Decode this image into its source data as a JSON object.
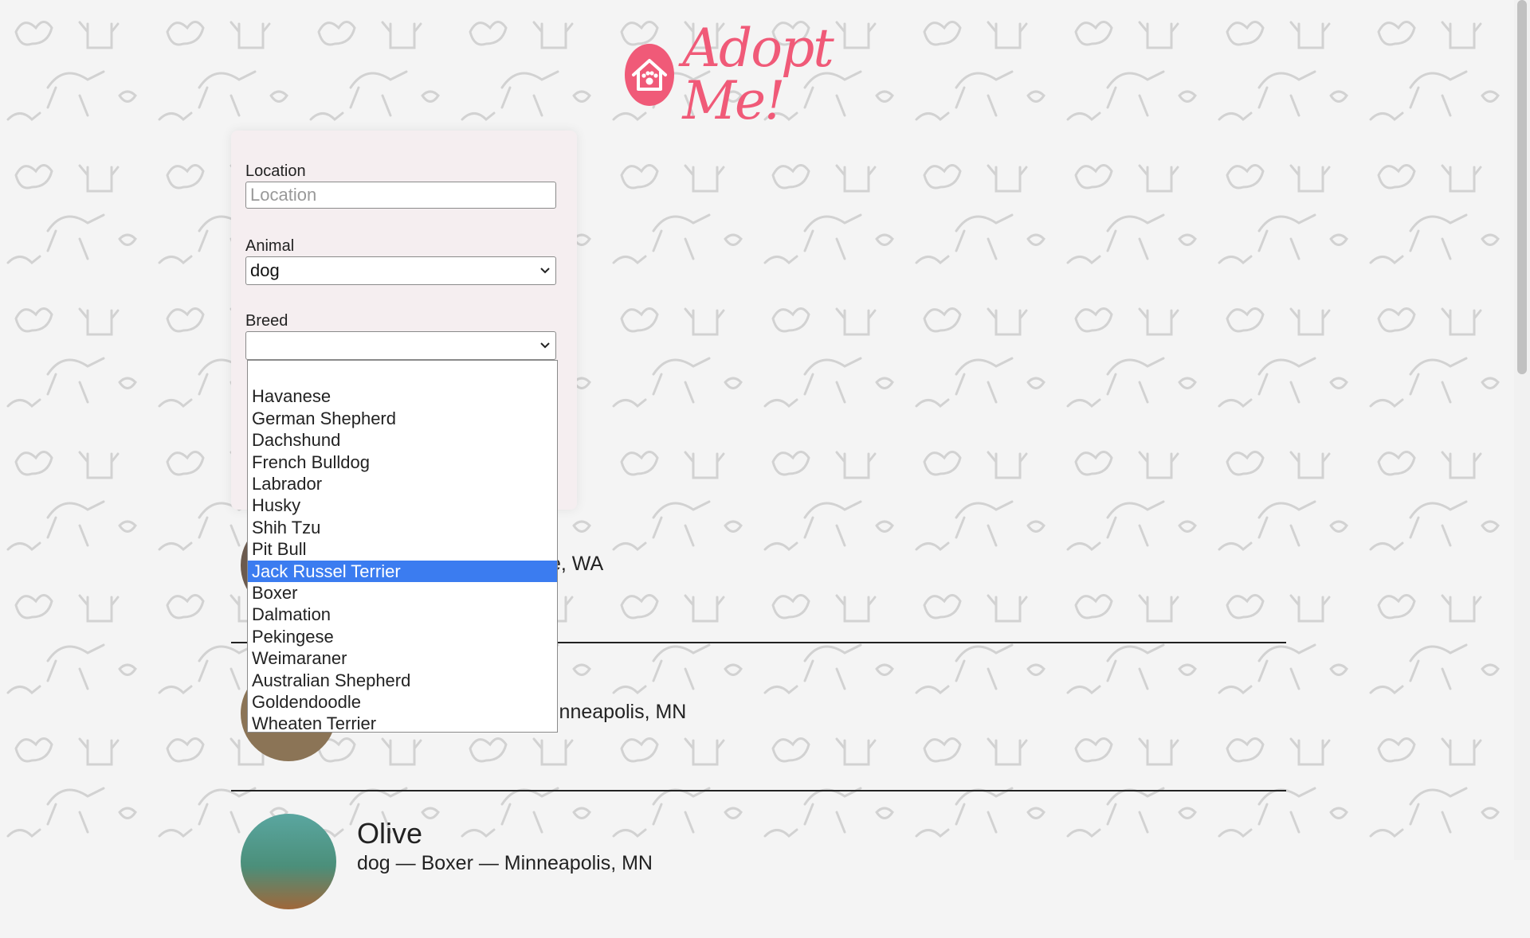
{
  "app": {
    "logo_text": "Adopt Me!"
  },
  "search": {
    "location_label": "Location",
    "location_placeholder": "Location",
    "location_value": "",
    "animal_label": "Animal",
    "animal_value": "dog",
    "breed_label": "Breed",
    "breed_value": ""
  },
  "breed_options": [
    "",
    "Havanese",
    "German Shepherd",
    "Dachshund",
    "French Bulldog",
    "Labrador",
    "Husky",
    "Shih Tzu",
    "Pit Bull",
    "Jack Russel Terrier",
    "Boxer",
    "Dalmation",
    "Pekingese",
    "Weimaraner",
    "Australian Shepherd",
    "Goldendoodle",
    "Wheaten Terrier"
  ],
  "highlighted_breed": "Jack Russel Terrier",
  "pets": [
    {
      "meta_visible": "e, WA"
    },
    {
      "meta_visible": "inneapolis, MN"
    },
    {
      "name": "Olive",
      "meta": "dog — Boxer — Minneapolis, MN"
    }
  ],
  "colors": {
    "brand": "#f05a78",
    "highlight": "#3b7cf0",
    "panel": "#f5eef0"
  },
  "icons": {
    "logo": "house-paw-icon",
    "select": "chevron-down-icon"
  }
}
